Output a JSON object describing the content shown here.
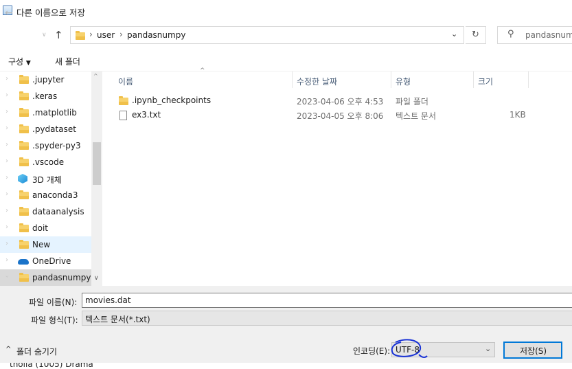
{
  "window": {
    "title": "다른 이름으로 저장"
  },
  "address": {
    "crumbs": [
      "user",
      "pandasnumpy"
    ],
    "search_placeholder": "pandasnumpy"
  },
  "toolbar": {
    "organize": "구성",
    "new_folder": "새 폴더"
  },
  "nav_items": [
    {
      "label": ".jupyter",
      "icon": "folder-icon"
    },
    {
      "label": ".keras",
      "icon": "folder-icon"
    },
    {
      "label": ".matplotlib",
      "icon": "folder-icon"
    },
    {
      "label": ".pydataset",
      "icon": "folder-icon"
    },
    {
      "label": ".spyder-py3",
      "icon": "folder-icon"
    },
    {
      "label": ".vscode",
      "icon": "folder-icon"
    },
    {
      "label": "3D 개체",
      "icon": "3d-objects-icon"
    },
    {
      "label": "anaconda3",
      "icon": "folder-icon"
    },
    {
      "label": "dataanalysis",
      "icon": "folder-icon"
    },
    {
      "label": "doit",
      "icon": "folder-icon"
    },
    {
      "label": "New",
      "icon": "folder-icon"
    },
    {
      "label": "OneDrive",
      "icon": "onedrive-icon"
    },
    {
      "label": "pandasnumpy",
      "icon": "folder-icon"
    }
  ],
  "columns": {
    "name": "이름",
    "modified": "수정한 날짜",
    "type": "유형",
    "size": "크기"
  },
  "files": [
    {
      "name": ".ipynb_checkpoints",
      "modified": "2023-04-06 오후 4:53",
      "type": "파일 폴더",
      "size": "",
      "icon": "folder-icon"
    },
    {
      "name": "ex3.txt",
      "modified": "2023-04-05 오후 8:06",
      "type": "텍스트 문서",
      "size": "1KB",
      "icon": "text-file-icon"
    }
  ],
  "form": {
    "filename_label": "파일 이름(N):",
    "filename_value": "movies.dat",
    "filetype_label": "파일 형식(T):",
    "filetype_value": "텍스트 문서(*.txt)",
    "hide_folders": "폴더 숨기기",
    "encoding_label": "인코딩(E):",
    "encoding_value": "UTF-8",
    "save_button": "저장(S)"
  },
  "background_text": "tholla (1005) Drama"
}
